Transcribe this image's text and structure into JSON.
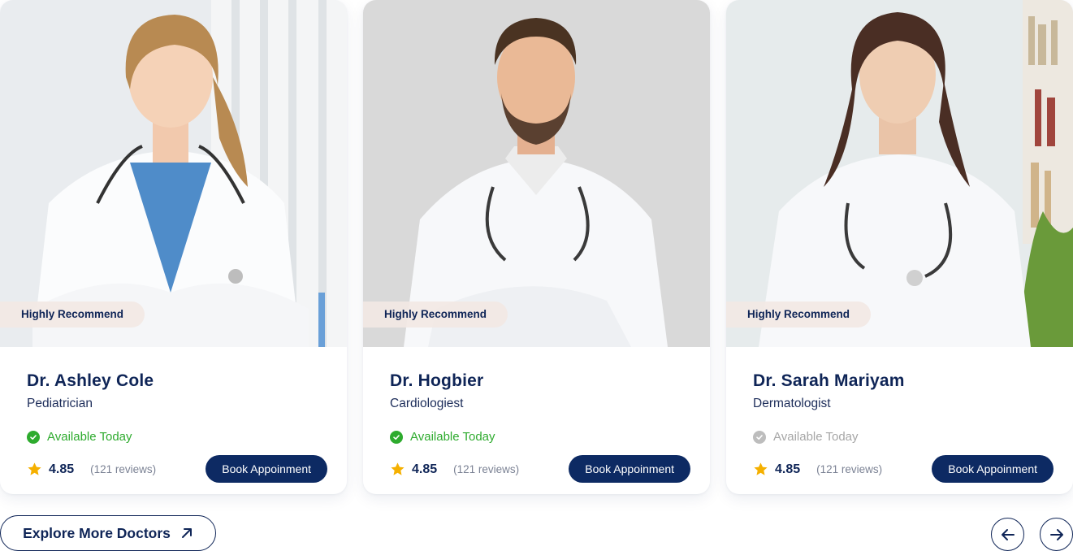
{
  "doctors": [
    {
      "badge": "Highly Recommend",
      "name": "Dr. Ashley Cole",
      "specialty": "Pediatrician",
      "availability": "Available Today",
      "available": true,
      "rating": "4.85",
      "reviews": "(121 reviews)",
      "book_label": "Book Appoinment"
    },
    {
      "badge": "Highly Recommend",
      "name": "Dr. Hogbier",
      "specialty": "Cardiologiest",
      "availability": "Available Today",
      "available": true,
      "rating": "4.85",
      "reviews": "(121 reviews)",
      "book_label": "Book Appoinment"
    },
    {
      "badge": "Highly Recommend",
      "name": "Dr. Sarah Mariyam",
      "specialty": "Dermatologist",
      "availability": "Available Today",
      "available": false,
      "rating": "4.85",
      "reviews": "(121 reviews)",
      "book_label": "Book Appoinment"
    }
  ],
  "footer": {
    "explore_label": "Explore More Doctors",
    "explore_icon": "arrow-up-right-icon",
    "prev_icon": "arrow-left-icon",
    "next_icon": "arrow-right-icon"
  },
  "colors": {
    "navy": "#0f2557",
    "button": "#0d2a63",
    "available": "#2eab2e",
    "unavailable": "#a6a6a6",
    "star": "#f5b000"
  }
}
